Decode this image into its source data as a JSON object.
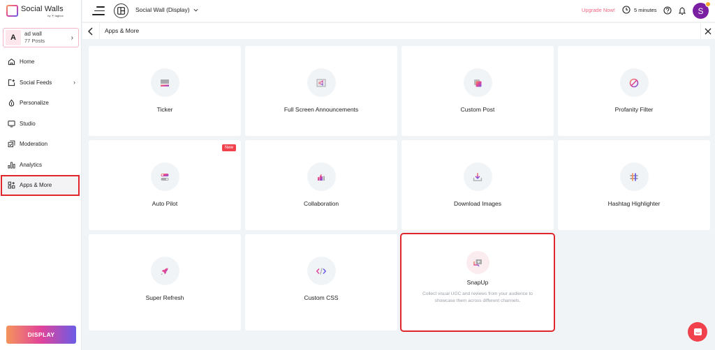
{
  "app": {
    "name": "Social Walls",
    "byline": "by ⦿ tagbox"
  },
  "account": {
    "initial": "A",
    "name": "ad wall",
    "posts": "77 Posts"
  },
  "sidebar": {
    "items": [
      {
        "label": "Home",
        "icon": "home-icon"
      },
      {
        "label": "Social Feeds",
        "icon": "add-feed-icon",
        "has_submenu": true
      },
      {
        "label": "Personalize",
        "icon": "drop-icon"
      },
      {
        "label": "Studio",
        "icon": "monitor-icon"
      },
      {
        "label": "Moderation",
        "icon": "moderation-icon"
      },
      {
        "label": "Analytics",
        "icon": "analytics-icon"
      },
      {
        "label": "Apps & More",
        "icon": "apps-icon",
        "active": true
      }
    ],
    "display_button": "DISPLAY"
  },
  "topbar": {
    "wall_selector": "Social Wall (Display)",
    "upgrade_link": "Upgrade Now!",
    "timer": "5 minutes",
    "user_initial": "S"
  },
  "subheader": {
    "title": "Apps & More"
  },
  "apps": [
    {
      "title": "Ticker",
      "icon": "ticker-icon"
    },
    {
      "title": "Full Screen Announcements",
      "icon": "announcement-icon"
    },
    {
      "title": "Custom Post",
      "icon": "custom-post-icon"
    },
    {
      "title": "Profanity Filter",
      "icon": "prohibited-icon"
    },
    {
      "title": "Auto Pilot",
      "icon": "toggle-icon",
      "badge": "New"
    },
    {
      "title": "Collaboration",
      "icon": "thumbs-up-icon"
    },
    {
      "title": "Download Images",
      "icon": "download-icon"
    },
    {
      "title": "Hashtag Highlighter",
      "icon": "hashtag-icon"
    },
    {
      "title": "Super Refresh",
      "icon": "rocket-icon"
    },
    {
      "title": "Custom CSS",
      "icon": "code-icon"
    },
    {
      "title": "SnapUp",
      "icon": "snapup-icon",
      "description": "Collect visual UGC and reviews from your audience to showcase them across different channels.",
      "highlighted": true
    }
  ],
  "colors": {
    "accent_gradient_start": "#f5945c",
    "accent_gradient_mid": "#e0439a",
    "accent_gradient_end": "#6b5ce6",
    "highlight_border": "#e0262b",
    "upgrade": "#f06680",
    "avatar": "#7a1fa2",
    "new_badge": "#f0414d"
  }
}
